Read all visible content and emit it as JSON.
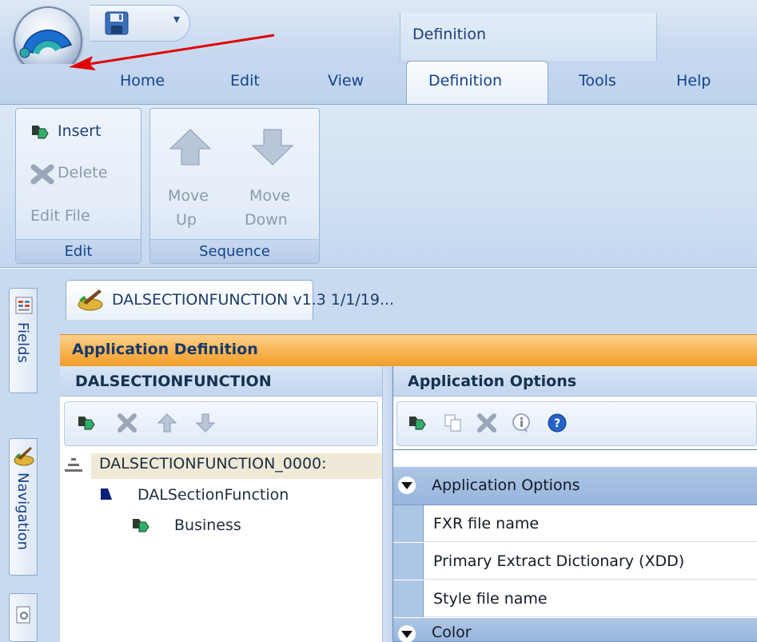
{
  "contextual_tab_group": "Definition",
  "tabs": [
    "Home",
    "Edit",
    "View",
    "Definition",
    "Tools",
    "Help"
  ],
  "active_tab": "Definition",
  "ribbon": {
    "edit_group": {
      "caption": "Edit",
      "insert": "Insert",
      "delete": "Delete",
      "edit_file": "Edit File"
    },
    "sequence_group": {
      "caption": "Sequence",
      "move_up_1": "Move",
      "move_up_2": "Up",
      "move_down_1": "Move",
      "move_down_2": "Down"
    }
  },
  "side_tabs": [
    "Fields",
    "Navigation"
  ],
  "document_tab": "DALSECTIONFUNCTION v1.3 1/1/19...",
  "app_definition_title": "Application Definition",
  "left_panel": {
    "title": "DALSECTIONFUNCTION",
    "tree": {
      "root": "DALSECTIONFUNCTION_0000:",
      "child": "DALSectionFunction",
      "grandchild": "Business"
    }
  },
  "right_panel": {
    "title": "Application Options",
    "categories": [
      {
        "name": "Application Options",
        "rows": [
          "FXR file name",
          "Primary Extract Dictionary (XDD)",
          "Style file name"
        ]
      },
      {
        "name": "Color"
      }
    ]
  },
  "colors": {
    "ribbon_blue": "#c5d8ef",
    "header_orange": "#f7b04a",
    "annotation_red": "#e00000"
  }
}
